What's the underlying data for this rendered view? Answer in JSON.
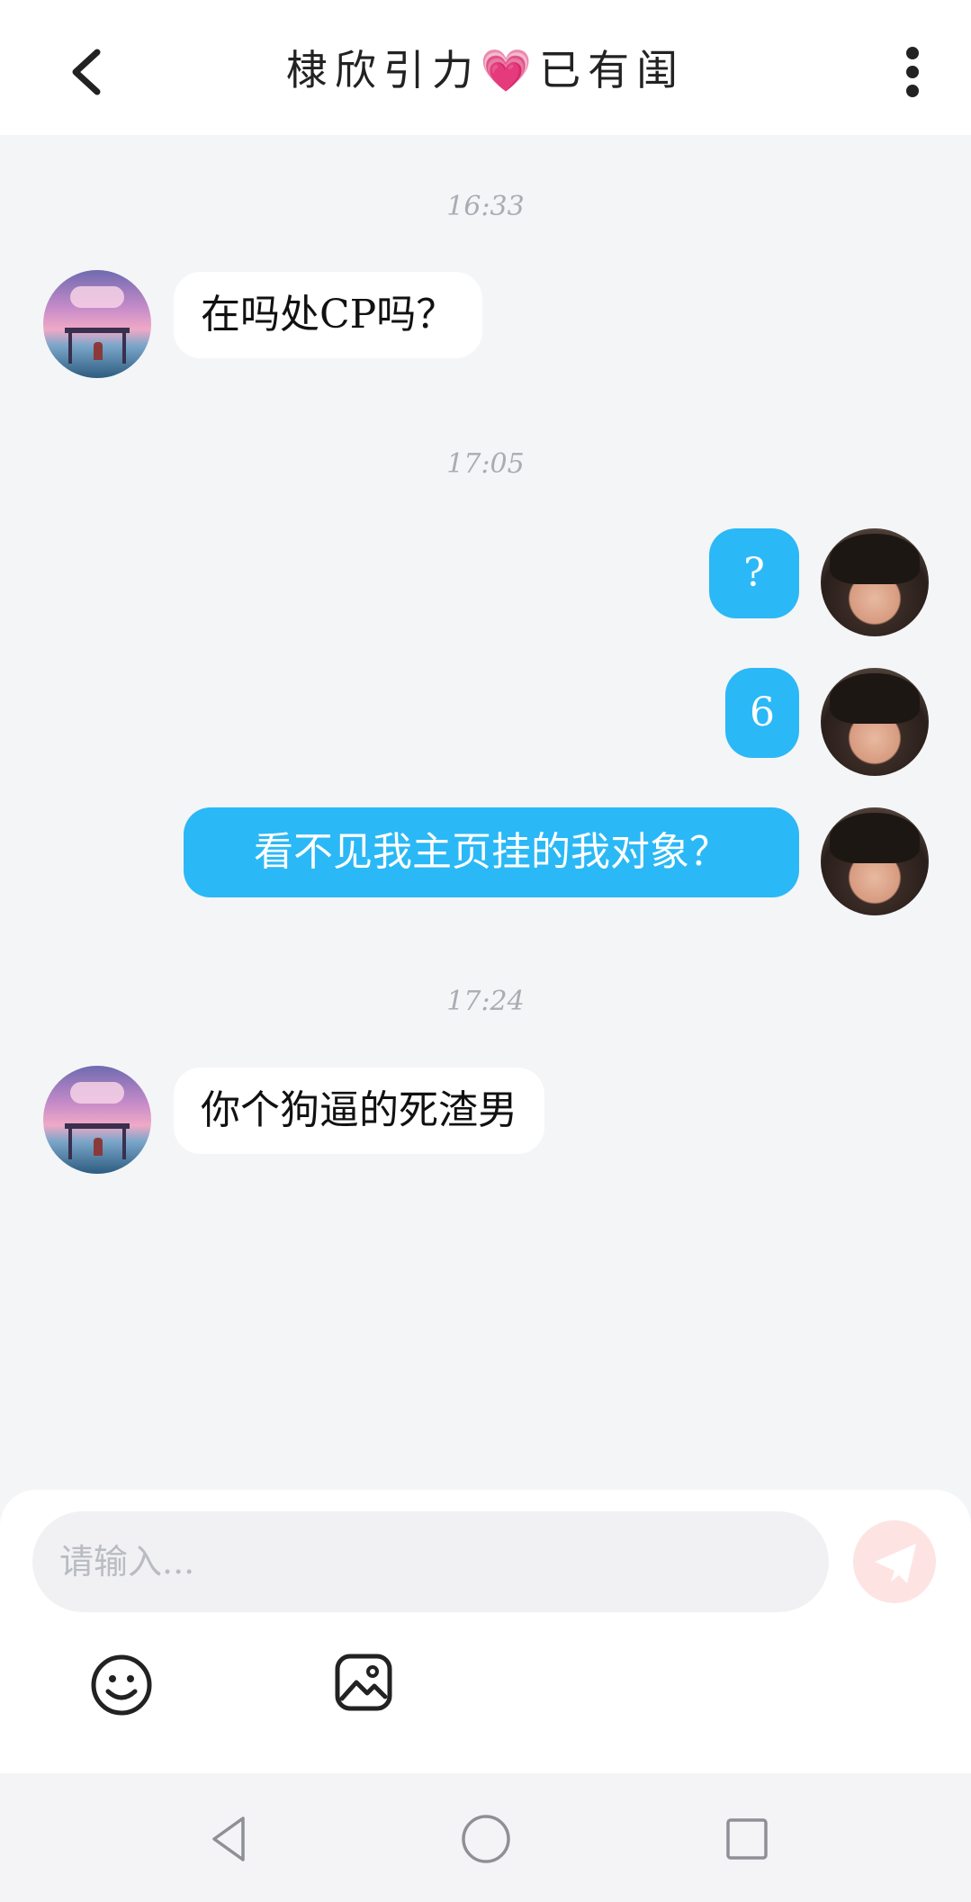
{
  "header": {
    "title_part1": "棣欣引力",
    "title_heart": "💗",
    "title_part2": "已有闺"
  },
  "messages": [
    {
      "time": "16:33"
    },
    {
      "side": "in",
      "text": "在吗处CP吗？"
    },
    {
      "time": "17:05"
    },
    {
      "side": "out",
      "text": "?"
    },
    {
      "side": "out",
      "text": "6"
    },
    {
      "side": "out",
      "text": "看不见我主页挂的我对象？"
    },
    {
      "time": "17:24"
    },
    {
      "side": "in",
      "text": "你个狗逼的死渣男"
    }
  ],
  "composer": {
    "placeholder": "请输入...",
    "value": ""
  },
  "colors": {
    "outgoing_bubble": "#2bb8f6",
    "incoming_bubble": "#ffffff",
    "send_button": "#fde4e2",
    "background": "#f4f5f7"
  },
  "icons": [
    "chevron-left-icon",
    "more-vertical-icon",
    "send-icon",
    "smiley-icon",
    "image-icon",
    "nav-back-icon",
    "nav-home-icon",
    "nav-recents-icon"
  ]
}
